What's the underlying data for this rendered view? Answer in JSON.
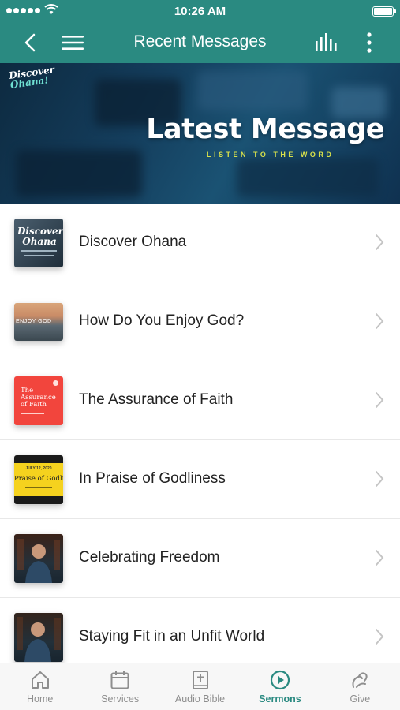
{
  "status_bar": {
    "time": "10:26 AM"
  },
  "nav": {
    "title": "Recent Messages"
  },
  "banner": {
    "logo_line1": "Discover",
    "logo_line2": "Ohana!",
    "title": "Latest Message",
    "subtitle": "LISTEN TO THE WORD"
  },
  "messages": [
    {
      "title": "Discover Ohana",
      "thumb_text": "Discover Ohana"
    },
    {
      "title": "How Do You Enjoy God?",
      "thumb_text": "ENJOY GOD"
    },
    {
      "title": "The Assurance of Faith",
      "thumb_text": "The Assurance of Faith"
    },
    {
      "title": "In Praise of Godliness",
      "thumb_text": "Praise of Godline",
      "thumb_date": "JULY 12, 2020"
    },
    {
      "title": "Celebrating Freedom"
    },
    {
      "title": "Staying Fit in an Unfit World"
    }
  ],
  "tabs": [
    {
      "label": "Home",
      "icon": "home-icon",
      "active": false
    },
    {
      "label": "Services",
      "icon": "calendar-icon",
      "active": false
    },
    {
      "label": "Audio Bible",
      "icon": "bible-icon",
      "active": false
    },
    {
      "label": "Sermons",
      "icon": "play-circle-icon",
      "active": true
    },
    {
      "label": "Give",
      "icon": "give-icon",
      "active": false
    }
  ],
  "colors": {
    "brand": "#2a8a81",
    "banner_subtitle": "#d8e04a",
    "tab_inactive": "#8e8e8e"
  }
}
